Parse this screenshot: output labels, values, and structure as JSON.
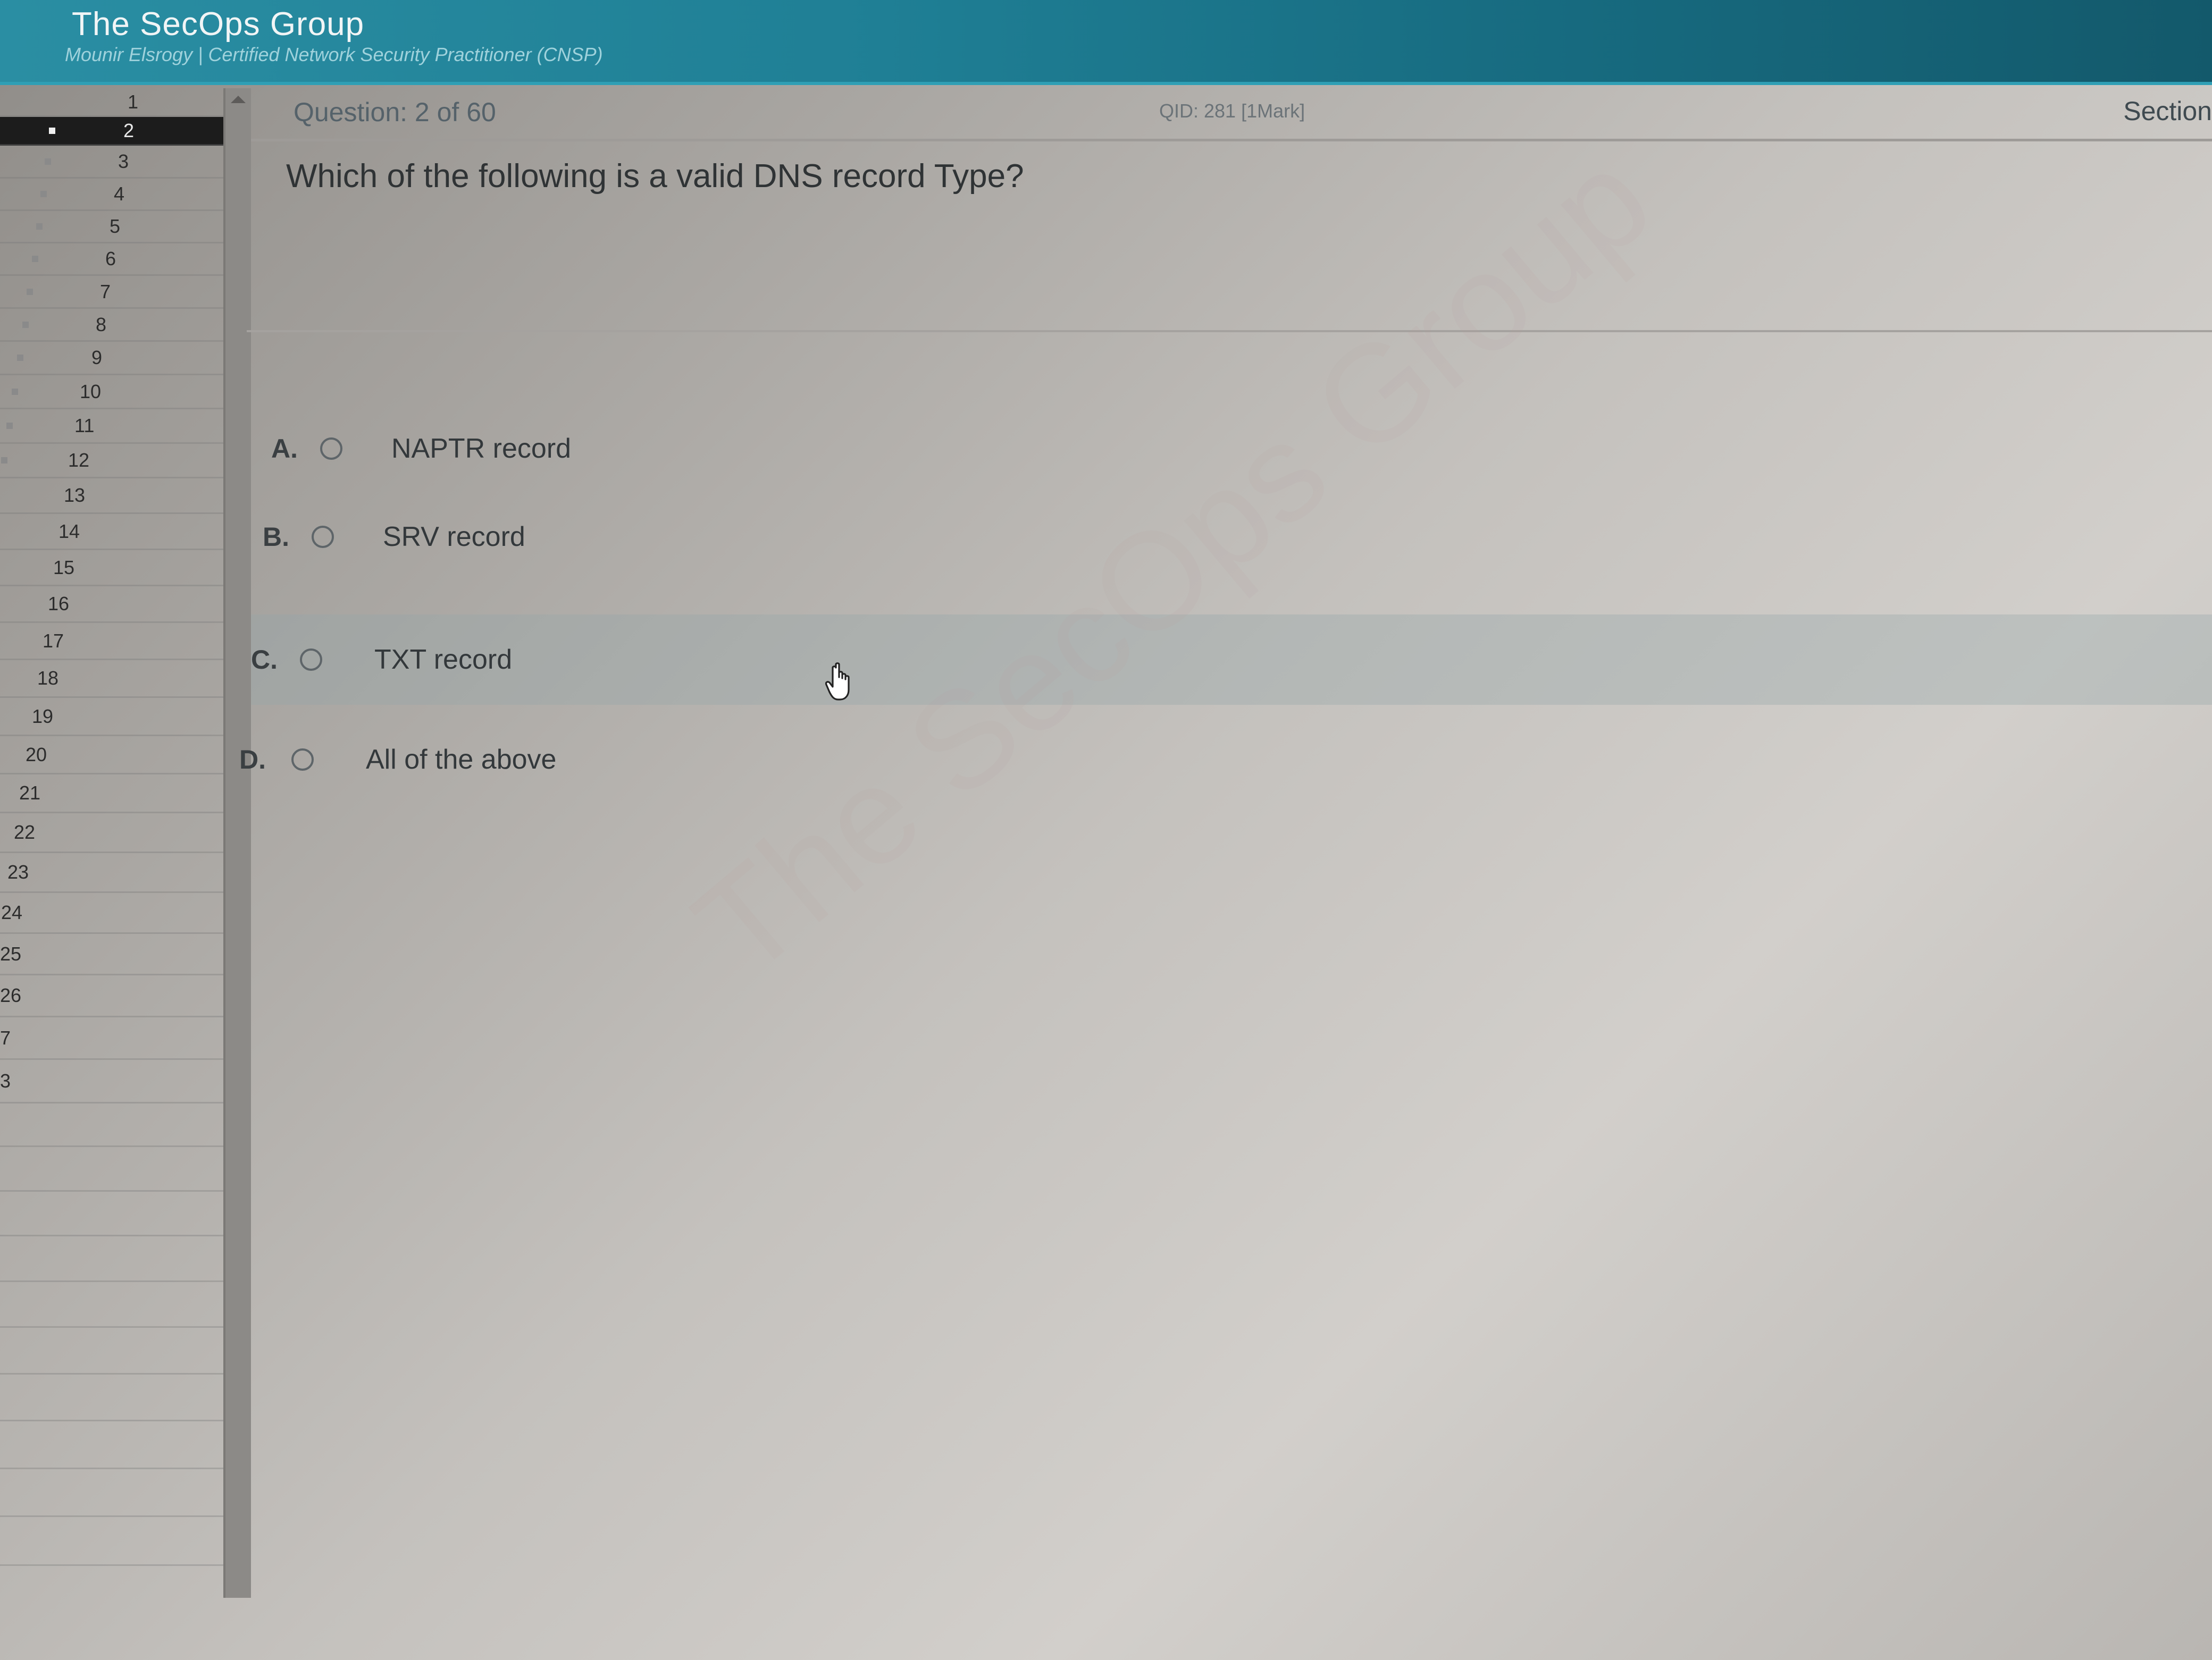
{
  "header": {
    "brand": "The SecOps Group",
    "subtitle": "Mounir Elsrogy | Certified Network Security Practitioner (CNSP)"
  },
  "sidebar": {
    "active": "2",
    "items": [
      "1",
      "2",
      "3",
      "4",
      "5",
      "6",
      "7",
      "8",
      "9",
      "10",
      "11",
      "12",
      "13",
      "14",
      "15",
      "16",
      "17",
      "18",
      "19",
      "20",
      "21",
      "22",
      "23",
      "24",
      "25",
      "26",
      "7",
      "3"
    ]
  },
  "question_bar": {
    "counter": "Question: 2 of 60",
    "qid": "QID: 281  [1Mark]",
    "section": "Section"
  },
  "question": {
    "text": "Which of the following is a valid DNS record Type?",
    "options": [
      {
        "letter": "A.",
        "text": "NAPTR record"
      },
      {
        "letter": "B.",
        "text": "SRV record"
      },
      {
        "letter": "C.",
        "text": "TXT record"
      },
      {
        "letter": "D.",
        "text": "All of the above"
      }
    ],
    "hovered": "C."
  },
  "watermark": "The SecOps Group",
  "icons": {
    "option_selector": "radio-button-icon",
    "pointer": "hand-pointer-icon",
    "scroll_up": "scroll-up-arrow-icon"
  }
}
